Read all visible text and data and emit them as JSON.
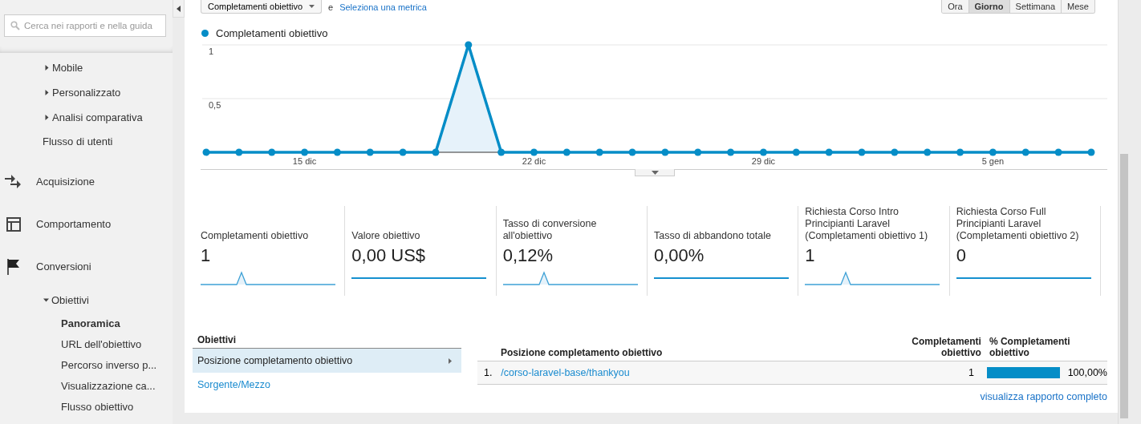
{
  "sidebar": {
    "search": {
      "placeholder": "Cerca nei rapporti e nella guida"
    },
    "items": [
      {
        "label": "Mobile",
        "kind": "group",
        "expanded": false
      },
      {
        "label": "Personalizzato",
        "kind": "group",
        "expanded": false
      },
      {
        "label": "Analisi comparativa",
        "kind": "group",
        "expanded": false
      },
      {
        "label": "Flusso di utenti",
        "kind": "link"
      },
      {
        "label": "Acquisizione",
        "kind": "section"
      },
      {
        "label": "Comportamento",
        "kind": "section"
      },
      {
        "label": "Conversioni",
        "kind": "section",
        "children": [
          {
            "label": "Obiettivi",
            "kind": "group",
            "expanded": true,
            "children": [
              {
                "label": "Panoramica",
                "kind": "leaf",
                "selected": true
              },
              {
                "label": "URL dell'obiettivo",
                "kind": "leaf",
                "selected": false
              },
              {
                "label": "Percorso inverso p...",
                "kind": "leaf",
                "selected": false
              },
              {
                "label": "Visualizzazione ca...",
                "kind": "leaf",
                "selected": false
              },
              {
                "label": "Flusso obiettivo",
                "kind": "leaf",
                "selected": false
              }
            ]
          }
        ]
      }
    ]
  },
  "toolbar": {
    "metric": "Completamenti obiettivo",
    "conjunction": "e",
    "add_metric": "Seleziona una metrica",
    "timeframes": [
      {
        "label": "Ora",
        "selected": false
      },
      {
        "label": "Giorno",
        "selected": true
      },
      {
        "label": "Settimana",
        "selected": false
      },
      {
        "label": "Mese",
        "selected": false
      }
    ]
  },
  "chart": {
    "chart_data": {
      "type": "area",
      "series": [
        {
          "name": "Completamenti obiettivo",
          "color": "#058dc7",
          "values": [
            0,
            0,
            0,
            0,
            0,
            0,
            0,
            0,
            1,
            0,
            0,
            0,
            0,
            0,
            0,
            0,
            0,
            0,
            0,
            0,
            0,
            0,
            0,
            0,
            0,
            0,
            0,
            0
          ]
        }
      ],
      "categories": [
        null,
        null,
        null,
        "15 dic",
        null,
        null,
        null,
        null,
        null,
        null,
        "22 dic",
        null,
        null,
        null,
        null,
        null,
        null,
        "29 dic",
        null,
        null,
        null,
        null,
        null,
        null,
        "5 gen",
        null,
        null,
        null
      ],
      "ylim": [
        0,
        1
      ],
      "yticks": [
        {
          "value": 0.5,
          "label": "0,5"
        },
        {
          "value": 1,
          "label": "1"
        }
      ]
    }
  },
  "scorecards": [
    {
      "label": "Completamenti obiettivo",
      "value": "1",
      "kind": "spike"
    },
    {
      "label": "Valore obiettivo",
      "value": "0,00 US$",
      "kind": "flat"
    },
    {
      "label": "Tasso di conversione all'obiettivo",
      "value": "0,12%",
      "kind": "spike"
    },
    {
      "label": "Tasso di abbandono totale",
      "value": "0,00%",
      "kind": "flat"
    },
    {
      "label": "Richiesta Corso Intro Principianti Laravel (Completamenti obiettivo 1)",
      "value": "1",
      "kind": "spike"
    },
    {
      "label": "Richiesta Corso Full Principianti Laravel (Completamenti obiettivo 2)",
      "value": "0",
      "kind": "flat"
    }
  ],
  "dimensions": {
    "title": "Obiettivi",
    "items": [
      {
        "label": "Posizione completamento obiettivo",
        "selected": true
      },
      {
        "label": "Sorgente/Mezzo",
        "selected": false
      }
    ]
  },
  "table": {
    "columns": [
      "Posizione completamento obiettivo",
      "Completamenti obiettivo",
      "% Completamenti obiettivo"
    ],
    "rows": [
      {
        "index": "1.",
        "page": "/corso-laravel-base/thankyou",
        "completions": "1",
        "percent": "100,00%",
        "level": 1
      }
    ],
    "link": "visualizza rapporto completo"
  }
}
